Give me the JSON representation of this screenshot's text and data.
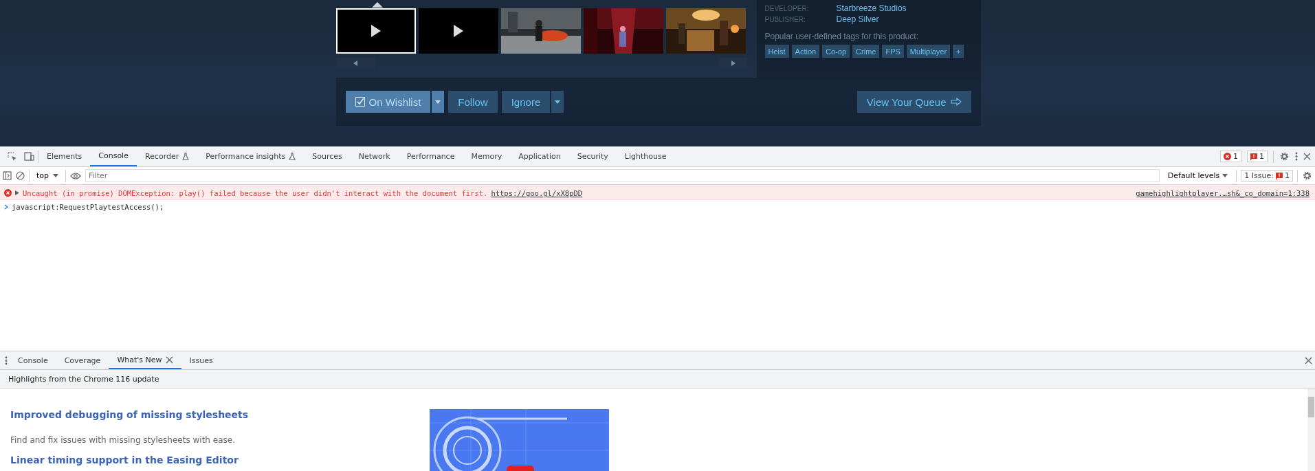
{
  "store": {
    "thumbnails": [
      {
        "kind": "video",
        "selected": true
      },
      {
        "kind": "video",
        "selected": false
      },
      {
        "kind": "picture",
        "selected": false
      },
      {
        "kind": "picture",
        "selected": false
      },
      {
        "kind": "picture",
        "selected": false
      }
    ],
    "details": [
      {
        "label": "DEVELOPER:",
        "value": "Starbreeze Studios"
      },
      {
        "label": "PUBLISHER:",
        "value": "Deep Silver"
      }
    ],
    "tags_label": "Popular user-defined tags for this product:",
    "tags": [
      "Heist",
      "Action",
      "Co-op",
      "Crime",
      "FPS",
      "Multiplayer",
      "+"
    ],
    "wishlist": {
      "label": "On Wishlist",
      "checked": true
    },
    "follow": "Follow",
    "ignore": "Ignore",
    "queue": "View Your Queue"
  },
  "devtools": {
    "tabs": [
      {
        "label": "Elements",
        "selected": false,
        "experiment": false
      },
      {
        "label": "Console",
        "selected": true,
        "experiment": false
      },
      {
        "label": "Recorder",
        "selected": false,
        "experiment": true
      },
      {
        "label": "Performance insights",
        "selected": false,
        "experiment": true
      },
      {
        "label": "Sources",
        "selected": false,
        "experiment": false
      },
      {
        "label": "Network",
        "selected": false,
        "experiment": false
      },
      {
        "label": "Performance",
        "selected": false,
        "experiment": false
      },
      {
        "label": "Memory",
        "selected": false,
        "experiment": false
      },
      {
        "label": "Application",
        "selected": false,
        "experiment": false
      },
      {
        "label": "Security",
        "selected": false,
        "experiment": false
      },
      {
        "label": "Lighthouse",
        "selected": false,
        "experiment": false
      }
    ],
    "error_count": "1",
    "issue_count": "1",
    "context": "top",
    "filter": {
      "placeholder": "Filter"
    },
    "levels": "Default levels",
    "issues_label": "1 Issue:",
    "issues_count": "1",
    "messages": [
      {
        "kind": "error",
        "text": "Uncaught (in promise) DOMException: play() failed because the user didn't interact with the document first.",
        "link": "https://goo.gl/xX8pDD",
        "source": "gamehighlightplayer.…sh&_co_domain=1:338"
      },
      {
        "kind": "input",
        "text": "javascript:RequestPlaytestAccess();"
      }
    ],
    "drawer": {
      "tabs": [
        {
          "label": "Console",
          "selected": false,
          "closable": false
        },
        {
          "label": "Coverage",
          "selected": false,
          "closable": false
        },
        {
          "label": "What's New",
          "selected": true,
          "closable": true
        },
        {
          "label": "Issues",
          "selected": false,
          "closable": false
        }
      ],
      "header": "Highlights from the Chrome 116 update",
      "articles": [
        {
          "title": "Improved debugging of missing stylesheets",
          "body": "Find and fix issues with missing stylesheets with ease."
        },
        {
          "title": "Linear timing support in the Easing Editor"
        }
      ]
    }
  }
}
